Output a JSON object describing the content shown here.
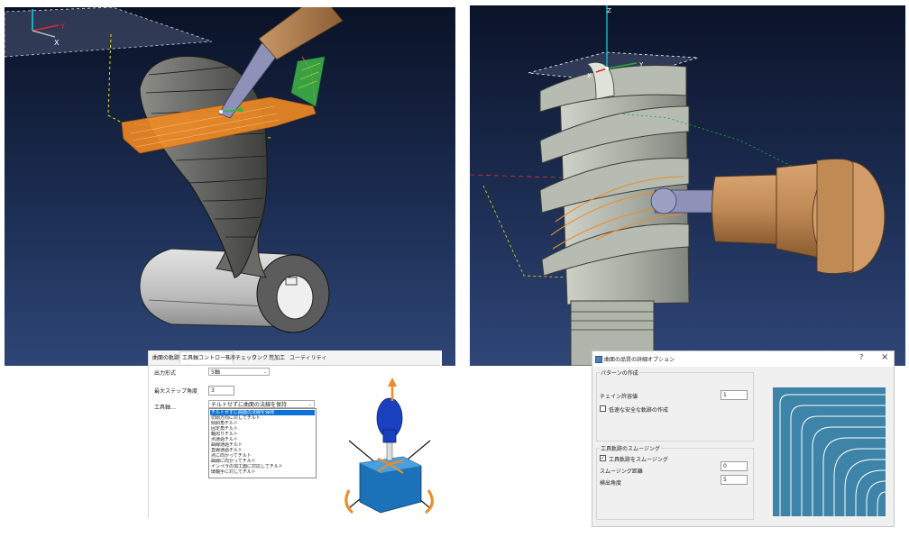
{
  "left_viewport": {
    "axis_labels": {
      "x": "X",
      "y": "Y"
    }
  },
  "right_viewport": {
    "axis_labels": {
      "x": "X",
      "y": "Y",
      "z": "Z"
    }
  },
  "left_dialog": {
    "tabs": [
      {
        "label": "曲面の軌跡",
        "active": false
      },
      {
        "label": "工具軸コントロール",
        "active": true
      },
      {
        "label": "干渉チェック",
        "active": false
      },
      {
        "label": "リンク",
        "active": false
      },
      {
        "label": "荒加工",
        "active": false
      },
      {
        "label": "ユーティリティ",
        "active": false
      }
    ],
    "output_format": {
      "label": "出力形式",
      "value": "5軸"
    },
    "max_step_angle": {
      "label": "最大ステップ角度",
      "value": "3"
    },
    "tool_axis": {
      "label": "工具軸…",
      "selected": "チルトせずに曲面の法線を保持",
      "options": [
        "チルトせずに曲面の法線を保持",
        "切削方向に対してチルト",
        "傾斜角チルト",
        "固定角チルト",
        "軸周りチルト",
        "点通過チルト",
        "曲線通過チルト",
        "直線通過チルト",
        "点に向かってチルト",
        "曲線に向かってチルト",
        "インペラの加工面に対応してチルト",
        "環軸手に対してチルト"
      ]
    }
  },
  "right_dialog": {
    "title": "曲面の品質の詳細オプション",
    "help_label": "?",
    "close_label": "×",
    "pattern_group": {
      "title": "パターンの作成",
      "chain_tolerance": {
        "label": "チェイン許容値",
        "value": "1"
      },
      "safe_path": {
        "label": "低速な安全な軌跡の作成",
        "checked": false
      }
    },
    "smoothing_group": {
      "title": "工具軌跡のスムージング",
      "smooth_toolpath": {
        "label": "工具軌跡をスムージング",
        "checked": true
      },
      "smoothing_distance": {
        "label": "スムージング距離",
        "value": "0"
      },
      "detection_angle": {
        "label": "検出角度",
        "value": "5"
      }
    }
  },
  "colors": {
    "viewport_top": "#0a1226",
    "viewport_bottom": "#2e4676",
    "toolpath_orange": "#f08a24",
    "part_gray": "#a9aea5",
    "holder_brown": "#c08a55",
    "selection_blue": "#0c71d6",
    "preview_blue": "#3e83a8"
  },
  "icons": [
    "axis-triad-icon",
    "tool-axis-illustration-icon",
    "dialog-app-icon",
    "help-icon",
    "close-icon",
    "checkbox-icon",
    "dropdown-arrow-icon"
  ]
}
